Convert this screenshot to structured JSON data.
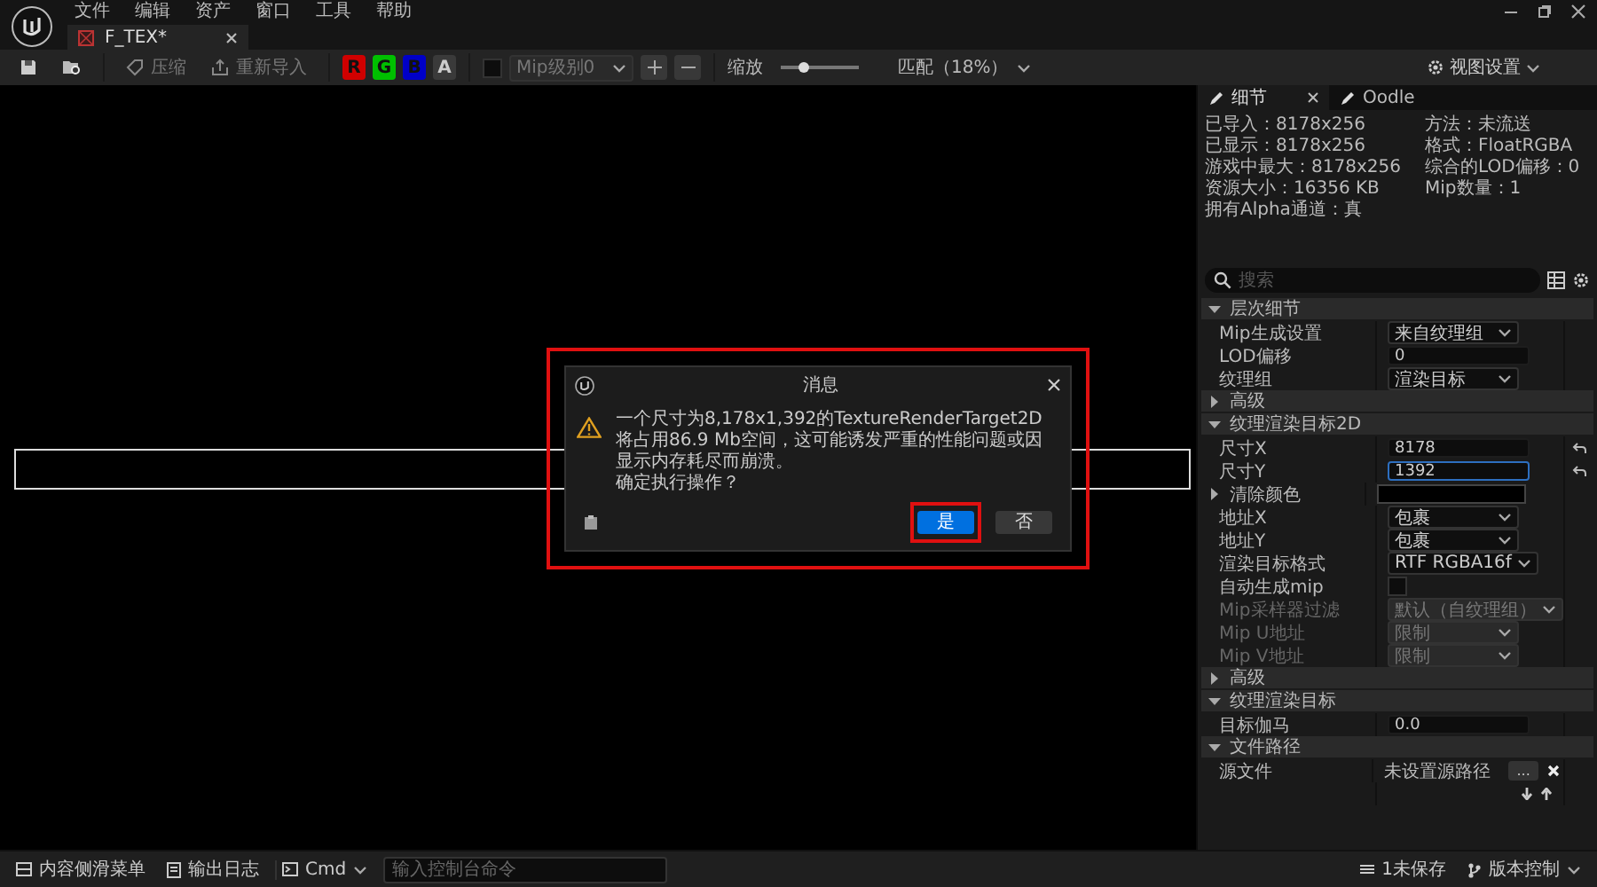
{
  "menu": [
    "文件",
    "编辑",
    "资产",
    "窗口",
    "工具",
    "帮助"
  ],
  "tab": {
    "label": "F_TEX*",
    "selected": true
  },
  "toolbar": {
    "actions": [
      {
        "label": "压缩",
        "disabled": true
      },
      {
        "label": "重新导入",
        "disabled": true
      }
    ],
    "channels": [
      {
        "label": "R",
        "on": true,
        "color": "#d00000"
      },
      {
        "label": "G",
        "on": true,
        "color": "#00c000"
      },
      {
        "label": "B",
        "on": true,
        "color": "#0000c8"
      },
      {
        "label": "A",
        "on": false
      }
    ],
    "mip_checkbox": {
      "checked": false
    },
    "mip_level": {
      "value": "Mip级别0",
      "disabled": true
    },
    "zoom": {
      "label": "缩放",
      "level": 0.3,
      "fit": "匹配（18%）"
    },
    "view_settings": "视图设置"
  },
  "details": {
    "tabs": [
      {
        "label": "细节",
        "selected": true
      },
      {
        "label": "Oodle",
        "selected": false
      }
    ],
    "info_left": [
      "已导入：8178x256",
      "已显示：8178x256",
      "游戏中最大：8178x256",
      "资源大小：16356 KB",
      "拥有Alpha通道：真"
    ],
    "info_right": [
      "方法：未流送",
      "格式：FloatRGBA",
      "综合的LOD偏移：0",
      "Mip数量：1"
    ],
    "search": {
      "placeholder": "搜索"
    },
    "sections": [
      {
        "title": "层次细节",
        "expanded": true,
        "rows": [
          {
            "kind": "dropdown",
            "label": "Mip生成设置",
            "value": "来自纹理组",
            "disabled": false
          },
          {
            "kind": "input",
            "label": "LOD偏移",
            "value": "0",
            "focused": false
          },
          {
            "kind": "dropdown",
            "label": "纹理组",
            "value": "渲染目标",
            "disabled": false
          }
        ]
      },
      {
        "title": "高级",
        "expanded": false
      },
      {
        "title": "纹理渲染目标2D",
        "expanded": true,
        "rows": [
          {
            "kind": "input",
            "label": "尺寸X",
            "value": "8178",
            "focused": false,
            "reset": true
          },
          {
            "kind": "input",
            "label": "尺寸Y",
            "value": "1392",
            "focused": true,
            "reset": true
          },
          {
            "kind": "color",
            "label": "清除颜色",
            "expanded": false,
            "color": "#000000"
          },
          {
            "kind": "dropdown",
            "label": "地址X",
            "value": "包裹",
            "disabled": false
          },
          {
            "kind": "dropdown",
            "label": "地址Y",
            "value": "包裹",
            "disabled": false
          },
          {
            "kind": "dropdown",
            "label": "渲染目标格式",
            "value": "RTF RGBA16f",
            "disabled": false
          },
          {
            "kind": "checkbox",
            "label": "自动生成mip",
            "checked": false
          },
          {
            "kind": "dropdown",
            "label": "Mip采样器过滤",
            "value": "默认（自纹理组）",
            "disabled": true
          },
          {
            "kind": "dropdown",
            "label": "Mip U地址",
            "value": "限制",
            "disabled": true
          },
          {
            "kind": "dropdown",
            "label": "Mip V地址",
            "value": "限制",
            "disabled": true
          }
        ]
      },
      {
        "title": "高级",
        "expanded": false
      },
      {
        "title": "纹理渲染目标",
        "expanded": true,
        "rows": [
          {
            "kind": "input",
            "label": "目标伽马",
            "value": "0.0",
            "focused": false
          }
        ]
      },
      {
        "title": "文件路径",
        "expanded": true,
        "rows": [
          {
            "kind": "file",
            "label": "源文件",
            "value": "未设置源路径",
            "button": "..."
          },
          {
            "kind": "arrows"
          }
        ]
      }
    ]
  },
  "dialog": {
    "title": "消息",
    "highlighted": true,
    "message": "一个尺寸为8,178x1,392的TextureRenderTarget2D将占用86.9 Mb空间，这可能诱发严重的性能问题或因显示内存耗尽而崩溃。",
    "question": "确定执行操作？",
    "buttons": [
      {
        "label": "是",
        "default": true,
        "highlighted": true
      },
      {
        "label": "否",
        "default": false,
        "highlighted": false
      }
    ]
  },
  "bottom_bar": {
    "left": [
      "内容侧滑菜单",
      "输出日志"
    ],
    "cmd": "Cmd",
    "console": {
      "placeholder": "输入控制台命令"
    },
    "right": [
      "1未保存",
      "版本控制"
    ]
  }
}
